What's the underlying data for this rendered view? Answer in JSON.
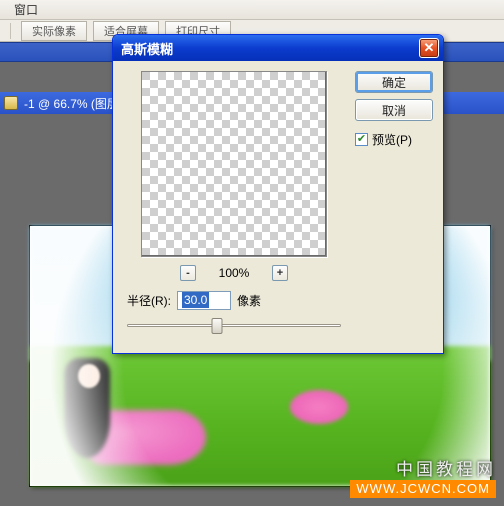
{
  "menubar": {
    "window": "窗口"
  },
  "options": {
    "actual_pixels": "实际像素",
    "fit_screen": "适合屏幕",
    "print_size": "打印尺寸"
  },
  "document": {
    "tab_title": "-1 @ 66.7% (图层"
  },
  "dialog": {
    "title": "高斯模糊",
    "ok": "确定",
    "cancel": "取消",
    "preview_checkbox": "预览(P)",
    "zoom_percent": "100%",
    "radius_label": "半径(R):",
    "radius_value": "30.0",
    "radius_unit": "像素",
    "zoom_out": "-",
    "zoom_in": "+"
  },
  "watermark": {
    "cn": "中国教程网",
    "url": "WWW.JCWCN.COM"
  }
}
